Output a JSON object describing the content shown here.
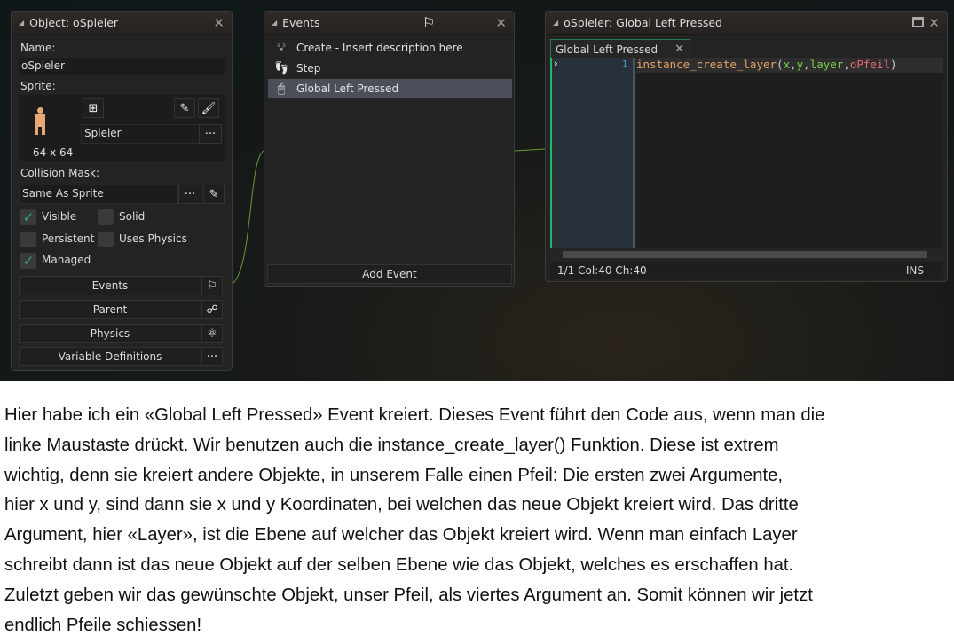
{
  "object_panel": {
    "title": "Object: oSpieler",
    "name_label": "Name:",
    "name_value": "oSpieler",
    "sprite_label": "Sprite:",
    "sprite_name": "Spieler",
    "sprite_size": "64 x 64",
    "collision_label": "Collision Mask:",
    "collision_value": "Same As Sprite",
    "more": "···",
    "checkboxes": [
      {
        "label": "Visible",
        "checked": true
      },
      {
        "label": "Solid",
        "checked": false
      },
      {
        "label": "Persistent",
        "checked": false
      },
      {
        "label": "Uses Physics",
        "checked": false
      },
      {
        "label": "Managed",
        "checked": true
      }
    ],
    "buttons": [
      {
        "label": "Events",
        "icon": "flag-icon"
      },
      {
        "label": "Parent",
        "icon": "hierarchy-icon"
      },
      {
        "label": "Physics",
        "icon": "atom-icon"
      },
      {
        "label": "Variable Definitions",
        "icon": "more-icon"
      }
    ]
  },
  "events_panel": {
    "title": "Events",
    "events": [
      {
        "label": "Create - Insert description here",
        "icon": "lightbulb-icon"
      },
      {
        "label": "Step",
        "icon": "footsteps-icon"
      },
      {
        "label": "Global Left Pressed",
        "icon": "mouse-icon",
        "selected": true
      }
    ],
    "add_event": "Add Event"
  },
  "code_panel": {
    "title": "oSpieler: Global Left Pressed",
    "tab": "Global Left Pressed",
    "line_number": "1",
    "code": {
      "func": "instance_create_layer",
      "open": "(",
      "a1": "x",
      "c1": ",",
      "a2": "y",
      "c2": ",",
      "a3": "layer",
      "c3": ",",
      "a4": "oPfeil",
      "close": ")"
    },
    "status": "1/1 Col:40 Ch:40",
    "mode": "INS"
  },
  "colors": {
    "func": "#e8a464",
    "arg": "#7ccf4e",
    "object": "#e86a6a",
    "check": "#27b36a"
  },
  "description": {
    "lines": [
      "Hier habe ich ein «Global Left Pressed» Event kreiert. Dieses Event führt den Code aus, wenn man die",
      "linke Maustaste drückt. Wir benutzen auch die instance_create_layer() Funktion. Diese ist extrem",
      "wichtig, denn sie kreiert andere Objekte, in unserem Falle einen Pfeil: Die ersten zwei Argumente,",
      "hier x und y, sind dann sie x und y Koordinaten, bei welchen das neue Objekt kreiert wird. Das dritte",
      "Argument, hier «Layer», ist die Ebene auf welcher das Objekt kreiert wird. Wenn man einfach Layer",
      "schreibt dann ist das neue Objekt auf der selben Ebene wie das Objekt, welches es erschaffen hat.",
      "Zuletzt geben wir das gewünschte Objekt, unser Pfeil, als viertes Argument an. Somit können wir jetzt",
      "endlich Pfeile schiessen!"
    ]
  }
}
